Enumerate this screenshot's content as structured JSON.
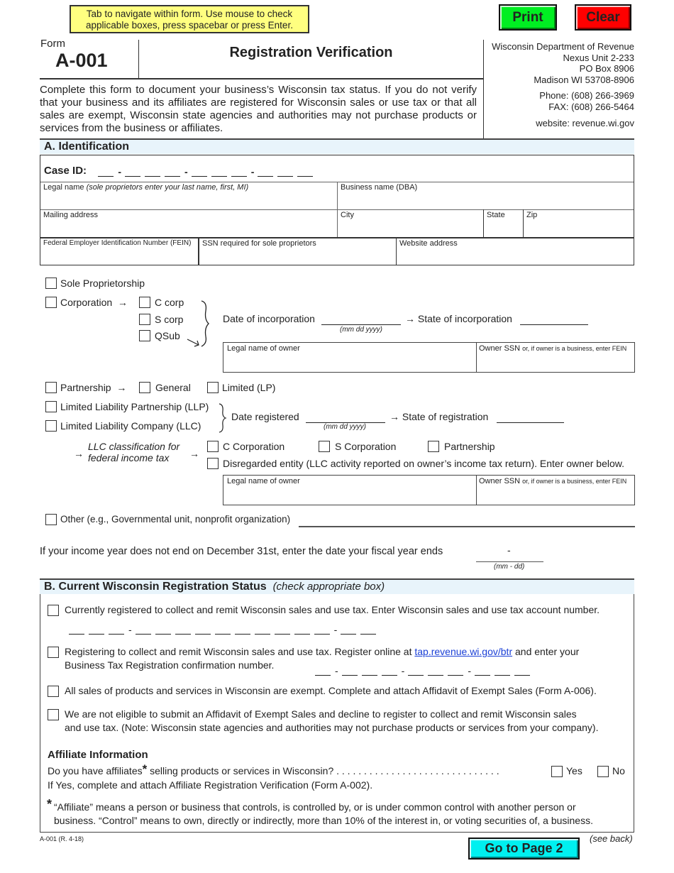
{
  "top": {
    "tip": "Tab to navigate within form. Use mouse to check applicable boxes, press spacebar or press Enter.",
    "print_label": "Print",
    "clear_label": "Clear",
    "colors": {
      "print": "#00ee22",
      "clear": "#ff0000",
      "go_page2": "#00f0f0",
      "tip_bg": "#ffff80",
      "section_bg": "#e8f4fb",
      "link": "#1a3fd6"
    }
  },
  "header": {
    "form_label": "Form",
    "form_number": "A-001",
    "title": "Registration Verification",
    "dept": [
      "Wisconsin Department of Revenue",
      "Nexus Unit  2-233",
      "PO Box 8906",
      "Madison WI  53708-8906"
    ],
    "phone": "Phone:  (608) 266-3969",
    "fax": "FAX:  (608) 266-5464",
    "website": "website:  revenue.wi.gov",
    "intro": "Complete this form to document your business’s Wisconsin tax status.  If you do not verify that your business and its affiliates are registered for Wisconsin sales or use tax or that all sales are exempt, Wisconsin state agencies and authorities may not purchase products or services from the business or affiliates."
  },
  "sectionA": {
    "title": "A.  Identification",
    "case_id_label": "Case ID:",
    "fields": {
      "legal_name": "Legal name",
      "legal_name_hint": "(sole proprietors enter your last name, first, MI)",
      "business_name": "Business name (DBA)",
      "mailing_address": "Mailing address",
      "city": "City",
      "state": "State",
      "zip": "Zip",
      "fein": "Federal Employer Identification Number (FEIN)",
      "ssn": "SSN required for sole proprietors",
      "website": "Website address"
    },
    "entity": {
      "sole_prop": "Sole Proprietorship",
      "corporation": "Corporation",
      "c_corp": "C corp",
      "s_corp": "S corp",
      "qsub": "QSub",
      "date_incorp": "Date of incorporation",
      "date_hint": "(mm dd yyyy)",
      "state_incorp": "State of incorporation",
      "owner_name": "Legal name of owner",
      "owner_ssn": "Owner SSN",
      "owner_ssn_hint": "or, if owner is a business, enter FEIN",
      "partnership": "Partnership",
      "general": "General",
      "limited": "Limited (LP)",
      "llp": "Limited Liability Partnership (LLP)",
      "llc": "Limited Liability Company (LLC)",
      "date_registered": "Date registered",
      "state_registration": "State of registration",
      "llc_class_1": "LLC classification for",
      "llc_class_2": "federal income tax",
      "c_corporation": "C Corporation",
      "s_corporation": "S Corporation",
      "llc_partnership": "Partnership",
      "disregarded": "Disregarded entity (LLC activity reported on owner’s income tax return).  Enter owner below.",
      "other": "Other (e.g., Governmental unit, nonprofit organization)"
    },
    "fiscal": "If your income year does not end on December 31st, enter the date your fiscal year ends",
    "fiscal_dash": "-",
    "fiscal_hint": "(mm - dd)"
  },
  "sectionB": {
    "title": "B.  Current Wisconsin Registration Status",
    "title_hint": "(check appropriate box)",
    "opt1": "Currently registered to collect and remit Wisconsin sales and use tax.  Enter Wisconsin sales and use tax account number.",
    "opt2_a": "Registering to collect and remit Wisconsin sales and use tax.  Register online at ",
    "opt2_link": "tap.revenue.wi.gov/btr",
    "opt2_b": " and enter your",
    "opt2_c": "Business Tax Registration confirmation number.",
    "opt3": "All sales of products and services in Wisconsin are exempt. Complete and attach Affidavit of Exempt Sales (Form A-006).",
    "opt4_a": "We are not eligible to submit an Affidavit of Exempt Sales and decline to register to collect and remit Wisconsin sales",
    "opt4_b": "and use tax.  (Note:  Wisconsin state agencies and authorities may not purchase products or services from your company).",
    "affiliate_title": "Affiliate Information",
    "affiliate_q_a": "Do you have affiliates",
    "star": "*",
    "affiliate_q_b": " selling products or services in Wisconsin? . . . . . . . . . . . . . . . . . . . . . . . . . . . . . .",
    "yes": "Yes",
    "no": "No",
    "affiliate_note": "If Yes, complete and attach Affiliate Registration Verification (Form A-002).",
    "def_a": "“Affiliate” means a person or business that controls, is controlled by, or is under common control with another person or",
    "def_b": "business. “Control” means to own, directly or indirectly, more than 10% of the interest in, or voting securities of, a business."
  },
  "footer": {
    "code": "A-001 (R. 4-18)",
    "go_page2": "Go to Page 2",
    "see_back": "(see back)"
  }
}
